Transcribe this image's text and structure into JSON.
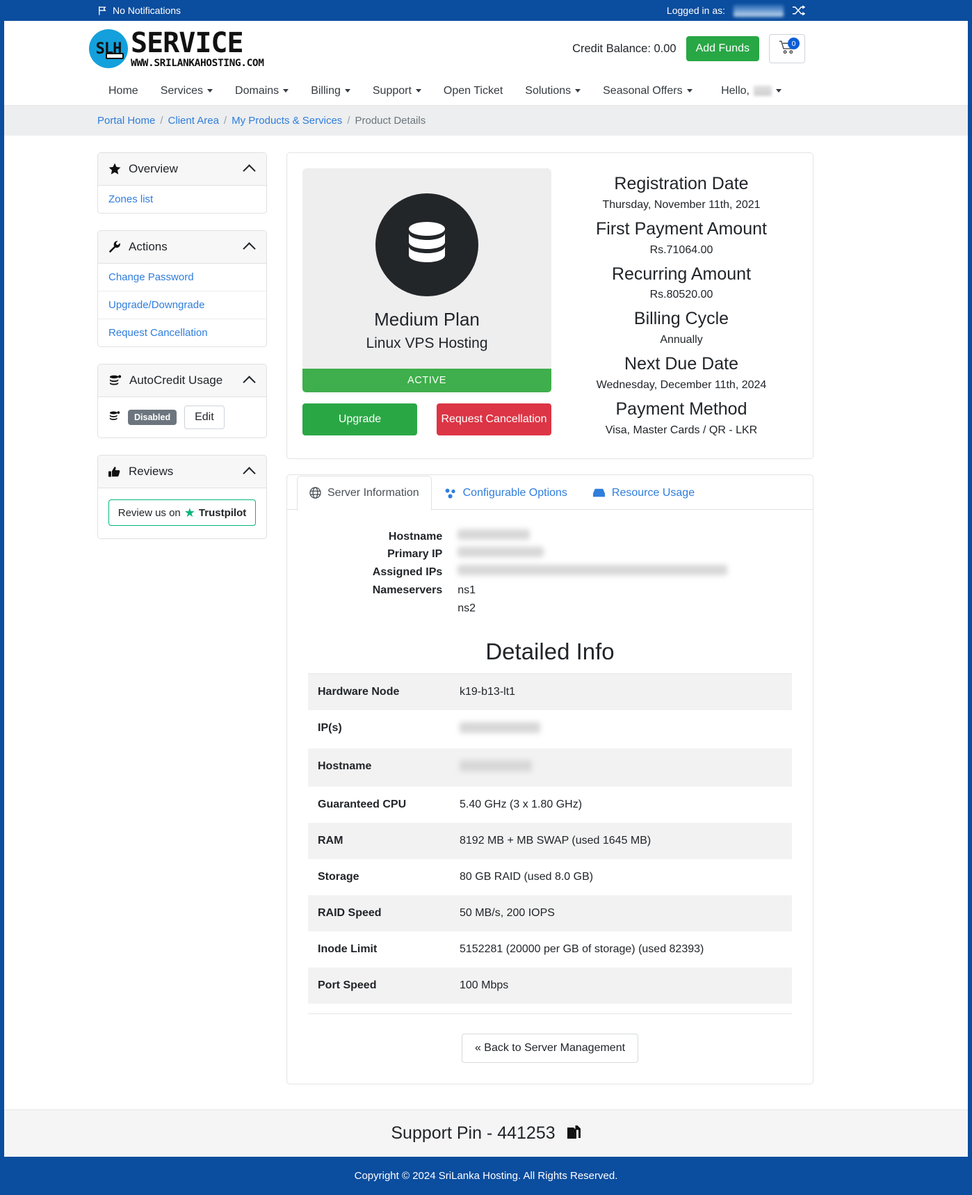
{
  "topbar": {
    "notifications_label": "No Notifications",
    "logged_in_label": "Logged in as:",
    "logged_in_user_redacted": true,
    "flag_icon": "flag-icon",
    "switch_icon": "shuffle-icon"
  },
  "header": {
    "logo_mark_text": "SLH",
    "logo_title": "SERVICE",
    "logo_subtitle": "WWW.SRILANKAHOSTING.COM",
    "credit_balance": "Credit Balance: 0.00",
    "add_funds_label": "Add Funds",
    "cart_icon": "cart-icon",
    "cart_count": "0"
  },
  "nav": {
    "items": [
      {
        "label": "Home",
        "has_caret": false
      },
      {
        "label": "Services",
        "has_caret": true
      },
      {
        "label": "Domains",
        "has_caret": true
      },
      {
        "label": "Billing",
        "has_caret": true
      },
      {
        "label": "Support",
        "has_caret": true
      },
      {
        "label": "Open Ticket",
        "has_caret": false
      },
      {
        "label": "Solutions",
        "has_caret": true
      },
      {
        "label": "Seasonal Offers",
        "has_caret": true
      }
    ],
    "hello_label": "Hello,"
  },
  "breadcrumb": {
    "items": [
      "Portal Home",
      "Client Area",
      "My Products & Services"
    ],
    "current": "Product Details",
    "separator": "/"
  },
  "sidebar": {
    "panels": [
      {
        "title": "Overview",
        "icon": "star-icon",
        "collapse_icon": "chevron-up-icon",
        "links": [
          "Zones list"
        ]
      },
      {
        "title": "Actions",
        "icon": "wrench-icon",
        "collapse_icon": "chevron-up-icon",
        "links": [
          "Change Password",
          "Upgrade/Downgrade",
          "Request Cancellation"
        ]
      },
      {
        "title": "AutoCredit Usage",
        "icon": "coins-icon",
        "collapse_icon": "chevron-up-icon",
        "status_badge": "Disabled",
        "edit_label": "Edit"
      },
      {
        "title": "Reviews",
        "icon": "thumbs-up-icon",
        "collapse_icon": "chevron-up-icon",
        "trustpilot_prefix": "Review us on",
        "trustpilot_name": "Trustpilot"
      }
    ]
  },
  "product": {
    "icon": "database-icon",
    "name": "Medium Plan",
    "group": "Linux VPS Hosting",
    "status": "ACTIVE",
    "status_color": "#3fae4c",
    "upgrade_label": "Upgrade",
    "cancel_label": "Request Cancellation"
  },
  "billing": {
    "fields": [
      {
        "label": "Registration Date",
        "value": "Thursday, November 11th, 2021"
      },
      {
        "label": "First Payment Amount",
        "value": "Rs.71064.00"
      },
      {
        "label": "Recurring Amount",
        "value": "Rs.80520.00"
      },
      {
        "label": "Billing Cycle",
        "value": "Annually"
      },
      {
        "label": "Next Due Date",
        "value": "Wednesday, December 11th, 2024"
      },
      {
        "label": "Payment Method",
        "value": "Visa, Master Cards / QR - LKR"
      }
    ]
  },
  "tabs": [
    {
      "label": "Server Information",
      "icon": "globe-icon",
      "active": true
    },
    {
      "label": "Configurable Options",
      "icon": "sliders-icon",
      "active": false
    },
    {
      "label": "Resource Usage",
      "icon": "inbox-icon",
      "active": false
    }
  ],
  "server_info": {
    "labels": [
      "Hostname",
      "Primary IP",
      "Assigned IPs",
      "Nameservers"
    ],
    "values": [
      "",
      "",
      "",
      "ns1"
    ],
    "nameserver_second": "ns2",
    "redacted": [
      "Hostname",
      "Primary IP",
      "Assigned IPs"
    ]
  },
  "detailed_info": {
    "title": "Detailed Info",
    "rows": [
      {
        "key": "Hardware Node",
        "value": "k19-b13-lt1",
        "redacted": false
      },
      {
        "key": "IP(s)",
        "value": "",
        "redacted": true
      },
      {
        "key": "Hostname",
        "value": "",
        "redacted": true
      },
      {
        "key": "Guaranteed CPU",
        "value": "5.40 GHz (3 x 1.80 GHz)",
        "redacted": false
      },
      {
        "key": "RAM",
        "value": "8192 MB + MB SWAP (used 1645 MB)",
        "redacted": false
      },
      {
        "key": "Storage",
        "value": "80 GB RAID (used 8.0 GB)",
        "redacted": false
      },
      {
        "key": "RAID Speed",
        "value": "50 MB/s, 200 IOPS",
        "redacted": false
      },
      {
        "key": "Inode Limit",
        "value": "5152281 (20000 per GB of storage) (used 82393)",
        "redacted": false
      },
      {
        "key": "Port Speed",
        "value": "100 Mbps",
        "redacted": false
      }
    ],
    "back_label": "« Back to Server Management"
  },
  "footer": {
    "support_pin": "Support Pin - 441253",
    "copy_icon": "copy-icon",
    "copyright": "Copyright © 2024 SriLanka Hosting. All Rights Reserved."
  },
  "colors": {
    "brand_blue": "#0b4d9e",
    "link_blue": "#2f7ddc",
    "success_green": "#28a745",
    "danger_red": "#dc3545",
    "trustpilot_green": "#00b67a"
  }
}
